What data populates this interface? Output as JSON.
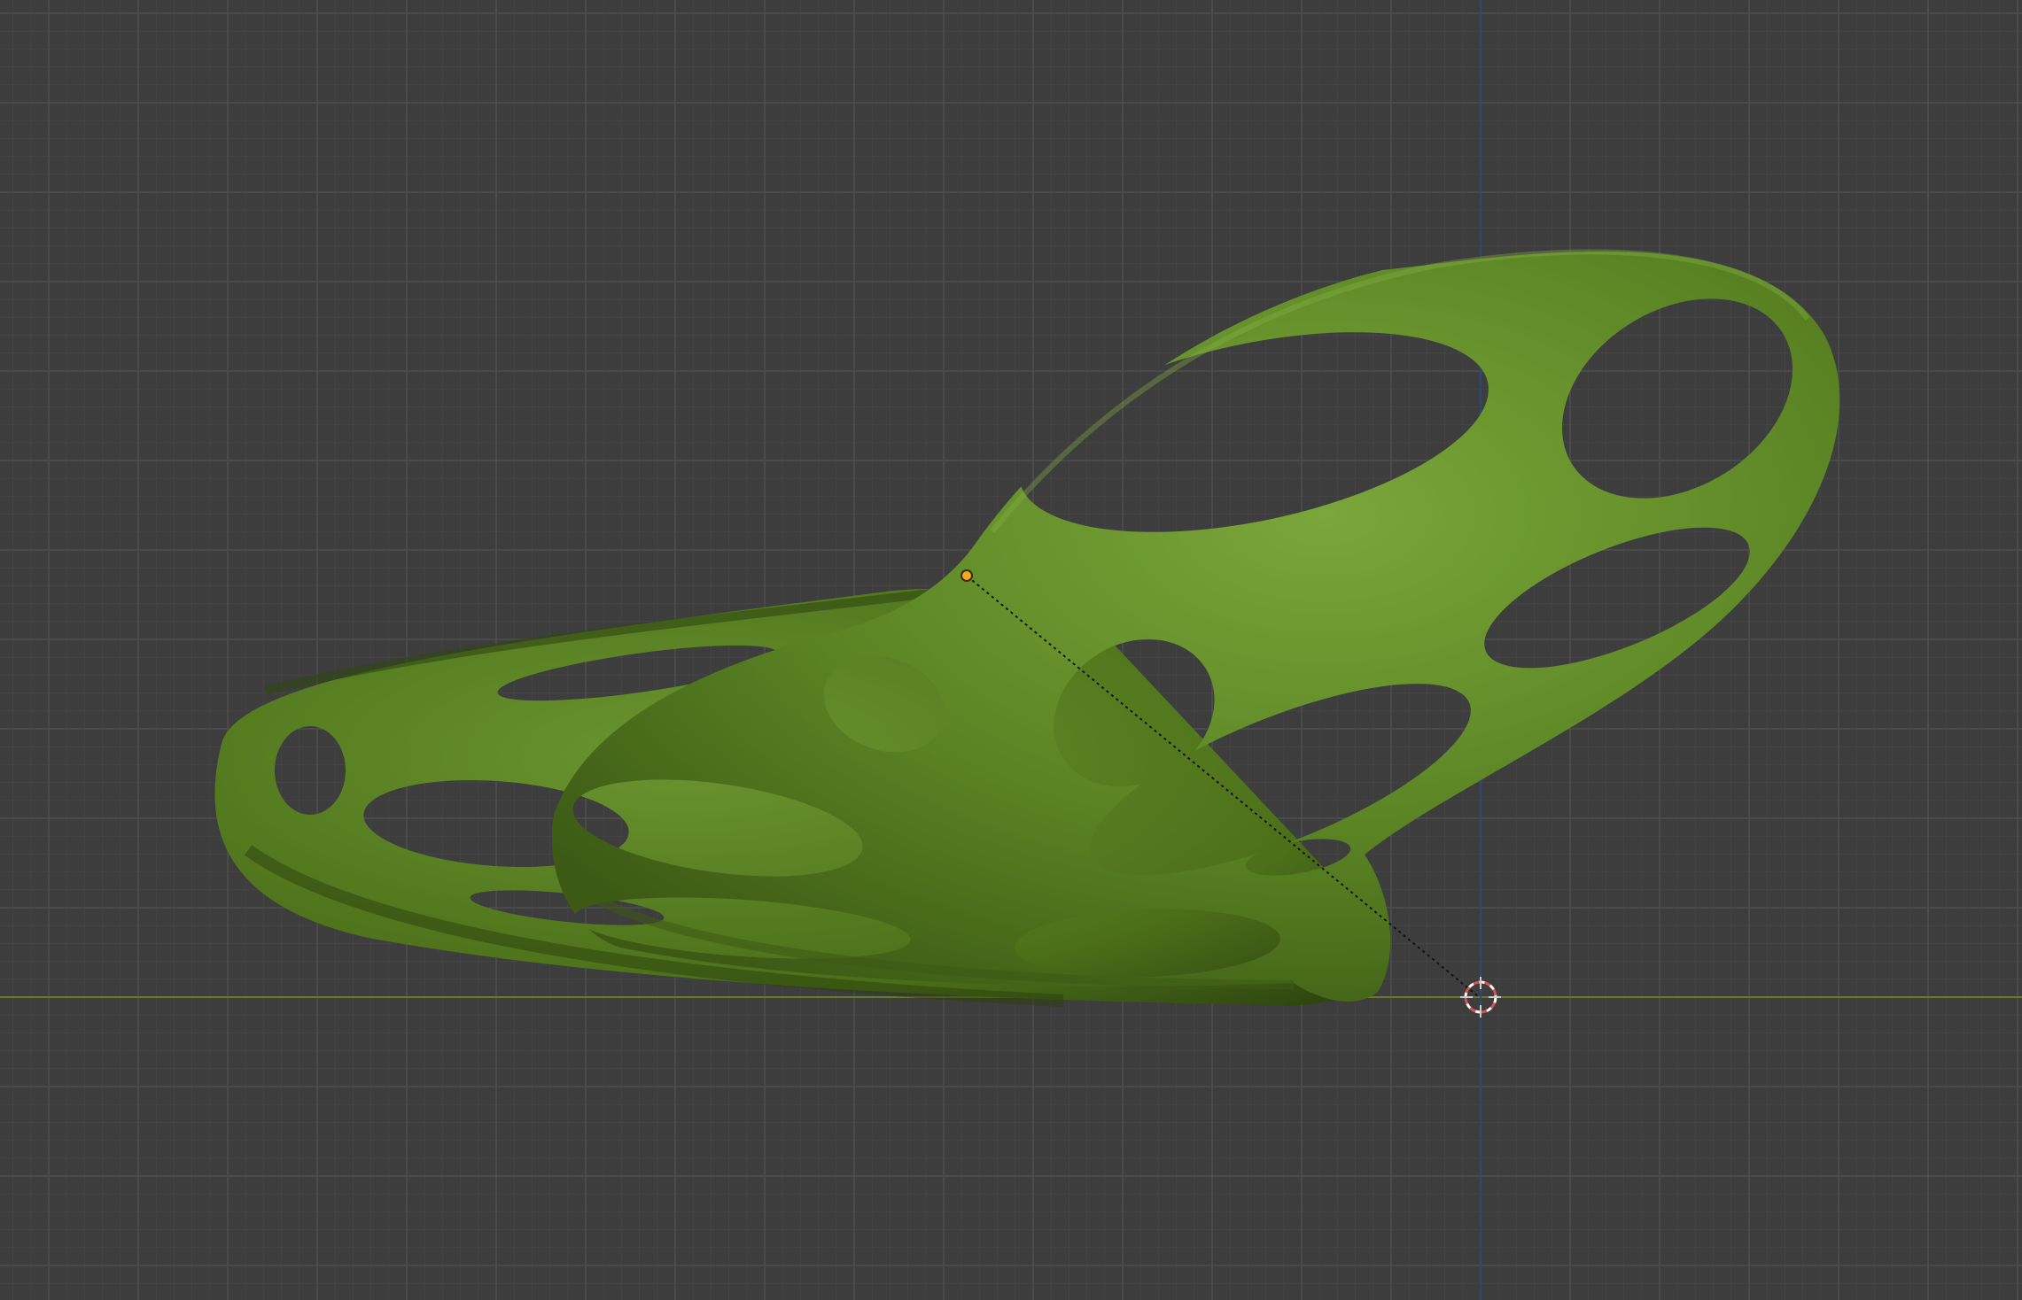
{
  "viewport": {
    "background": "#3d3d3d",
    "grid_minor_color": "#444444",
    "grid_major_color": "#4e4e4e",
    "axis_x_color": "#6a7a2a",
    "axis_z_color": "#2a4a7a"
  },
  "scene": {
    "object_color": "#5b8524",
    "object_highlight": "#7aa63a",
    "object_shadow": "#3c5a14",
    "origin_color": "#f5a623",
    "cursor_color": "#d9534f"
  },
  "icons": {
    "origin": "object-origin-dot",
    "cursor": "3d-cursor-icon"
  }
}
